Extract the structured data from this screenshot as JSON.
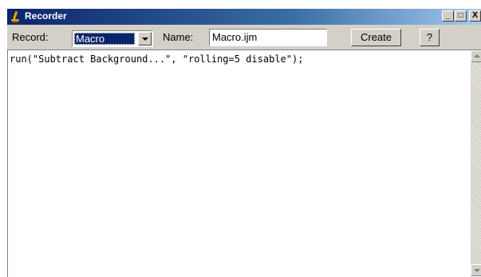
{
  "window": {
    "title": "Recorder",
    "app_icon": "imagej-microscope-icon",
    "controls": {
      "minimize": "_",
      "maximize": "□",
      "close": "X"
    }
  },
  "toolbar": {
    "record_label": "Record:",
    "record_value": "Macro",
    "name_label": "Name:",
    "name_value": "Macro.ijm",
    "create_label": "Create",
    "help_label": "?"
  },
  "editor": {
    "code": "run(\"Subtract Background...\", \"rolling=5 disable\");"
  },
  "colors": {
    "title_gradient_start": "#0a246a",
    "title_gradient_end": "#a6caf0",
    "selection": "#0a246a",
    "chrome": "#d4d0c8"
  }
}
